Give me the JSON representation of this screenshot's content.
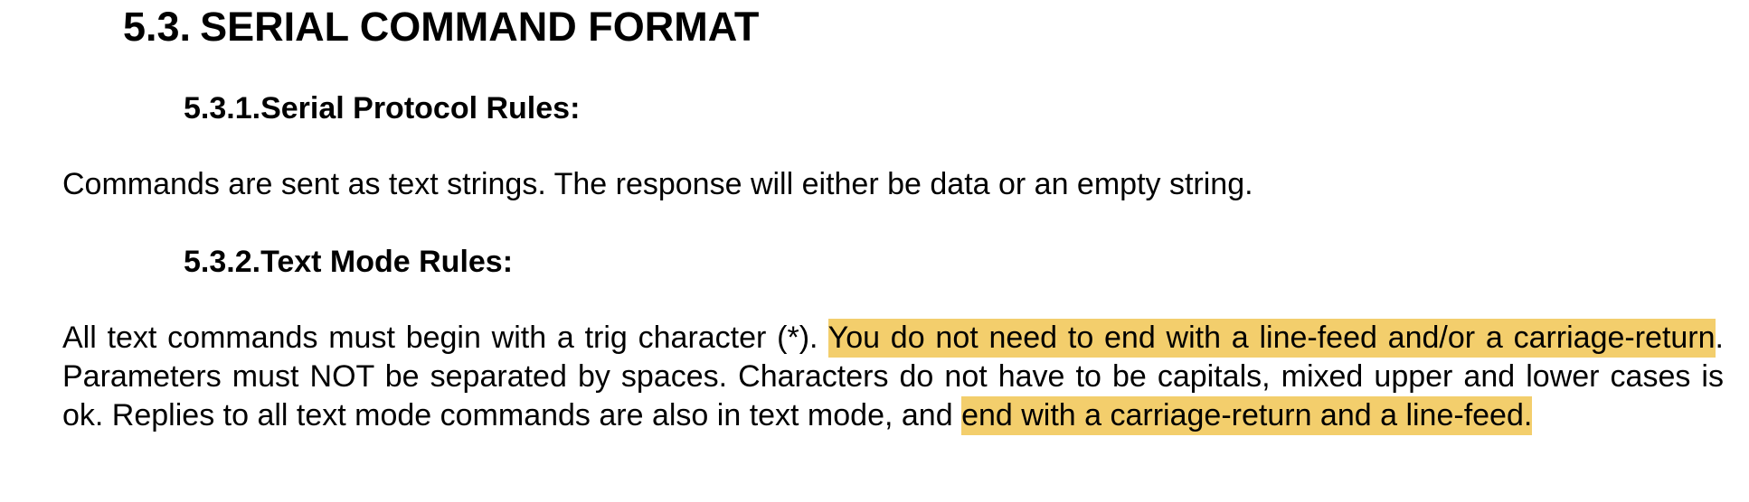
{
  "section": {
    "number": "5.3.",
    "title": "SERIAL COMMAND FORMAT"
  },
  "subsections": [
    {
      "number": "5.3.1.",
      "title": "Serial Protocol Rules:",
      "body": "Commands are sent as text strings. The response will either be data or an empty string."
    },
    {
      "number": "5.3.2.",
      "title": "Text Mode Rules:",
      "body_segments": [
        {
          "text": "All text commands must begin with a trig character (*). ",
          "highlighted": false
        },
        {
          "text": "You do not need to end with a line-feed and/or a carriage-return",
          "highlighted": true
        },
        {
          "text": ". Parameters must NOT be separated by spaces. Characters do not have to be capitals, mixed upper and lower cases is ok. Replies to all text mode commands are also in text mode, and ",
          "highlighted": false
        },
        {
          "text": "end with a carriage-return and a line-feed.",
          "highlighted": true
        }
      ]
    }
  ],
  "colors": {
    "highlight": "#f3ce6c",
    "text": "#000000",
    "background": "#ffffff"
  }
}
